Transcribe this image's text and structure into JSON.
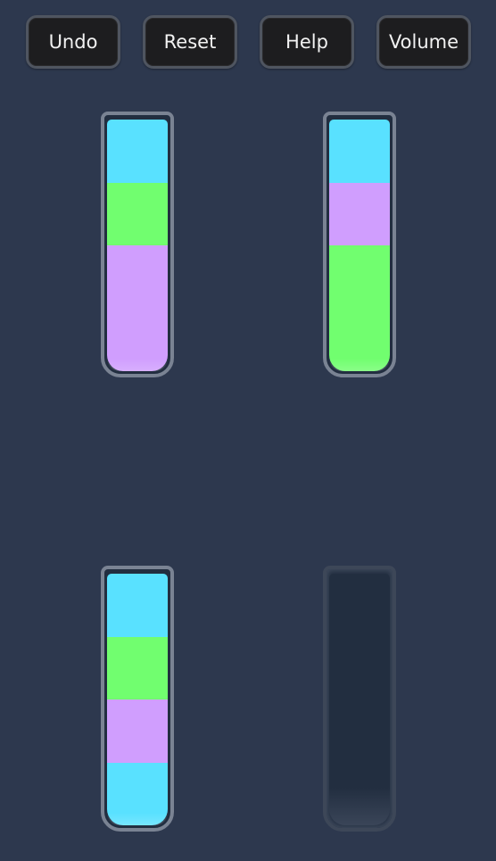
{
  "toolbar": {
    "buttons": [
      {
        "label": "Undo",
        "icon": "undo"
      },
      {
        "label": "Reset",
        "icon": "reset"
      },
      {
        "label": "Help",
        "icon": "help"
      },
      {
        "label": "Volume",
        "icon": "volume"
      }
    ]
  },
  "colors": {
    "background": "#2d384e",
    "cyan": "#59e1ff",
    "green": "#71fe6f",
    "purple": "#d09efe",
    "tube_border": "#7a8393",
    "tube_empty": "#222e40"
  },
  "tubes": [
    {
      "capacity": 4,
      "layers_top_to_bottom": [
        "cyan",
        "green",
        "purple",
        "purple"
      ]
    },
    {
      "capacity": 4,
      "layers_top_to_bottom": [
        "cyan",
        "purple",
        "green",
        "green"
      ]
    },
    {
      "capacity": 4,
      "layers_top_to_bottom": [
        "cyan",
        "green",
        "purple",
        "cyan"
      ]
    },
    {
      "capacity": 4,
      "layers_top_to_bottom": []
    }
  ]
}
